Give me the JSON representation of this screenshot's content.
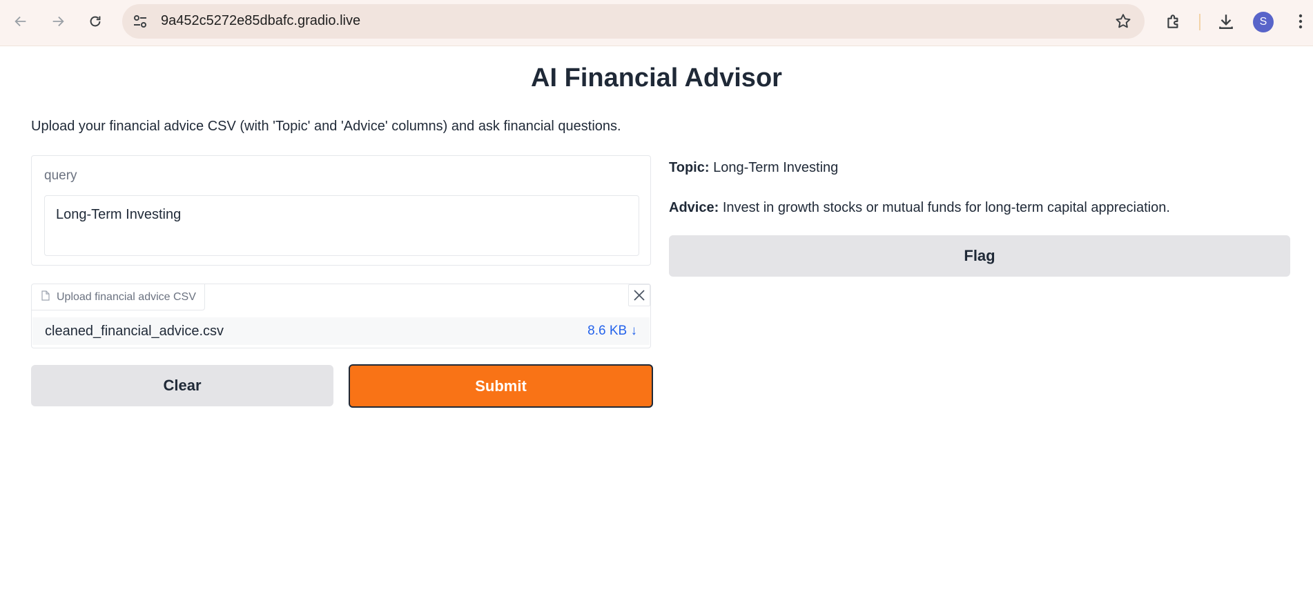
{
  "browser": {
    "url": "9a452c5272e85dbafc.gradio.live",
    "profile_initial": "S",
    "accent_color": "#5864c9"
  },
  "app": {
    "title": "AI Financial Advisor",
    "description": "Upload your financial advice CSV (with 'Topic' and 'Advice' columns) and ask financial questions."
  },
  "query": {
    "label": "query",
    "value": "Long-Term Investing"
  },
  "file_upload": {
    "label": "Upload financial advice CSV",
    "file_name": "cleaned_financial_advice.csv",
    "file_size": "8.6 KB ↓"
  },
  "buttons": {
    "clear": "Clear",
    "submit": "Submit",
    "flag": "Flag",
    "submit_color": "#f97316"
  },
  "output": {
    "topic_label": "Topic:",
    "topic_value": "Long-Term Investing",
    "advice_label": "Advice:",
    "advice_value": "Invest in growth stocks or mutual funds for long-term capital appreciation."
  }
}
